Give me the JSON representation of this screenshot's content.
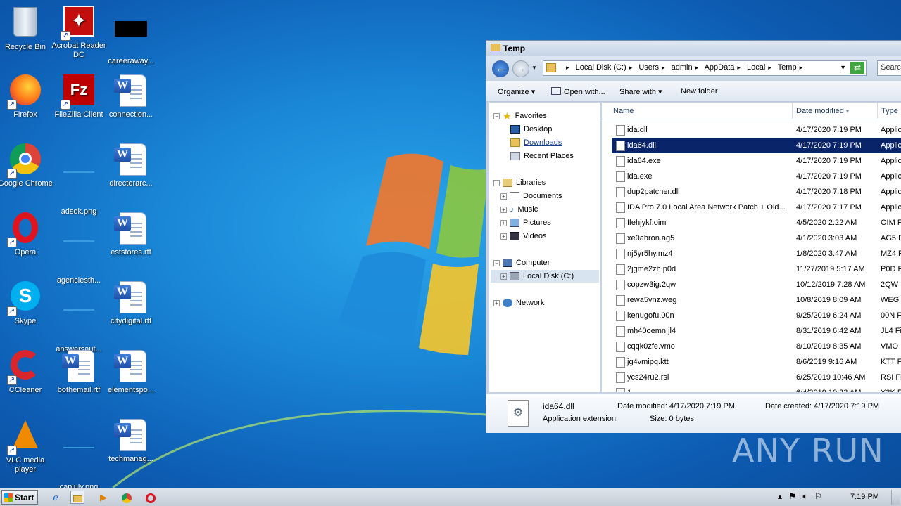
{
  "desktop_icons": [
    {
      "label": "Recycle Bin",
      "icon": "recycle-bin-icon"
    },
    {
      "label": "Acrobat Reader DC",
      "icon": "acrobat-icon"
    },
    {
      "label": "careeraway...",
      "icon": "black-file-icon"
    },
    {
      "label": "Firefox",
      "icon": "firefox-icon"
    },
    {
      "label": "FileZilla Client",
      "icon": "filezilla-icon"
    },
    {
      "label": "connection...",
      "icon": "word-doc-icon"
    },
    {
      "label": "Google Chrome",
      "icon": "chrome-icon"
    },
    {
      "label": "adsok.png",
      "icon": "png-file-icon"
    },
    {
      "label": "directorarc...",
      "icon": "word-doc-icon"
    },
    {
      "label": "Opera",
      "icon": "opera-icon"
    },
    {
      "label": "agenciesth...",
      "icon": "png-file-icon"
    },
    {
      "label": "eststores.rtf",
      "icon": "word-doc-icon"
    },
    {
      "label": "Skype",
      "icon": "skype-icon"
    },
    {
      "label": "answersaut...",
      "icon": "png-file-icon"
    },
    {
      "label": "citydigital.rtf",
      "icon": "word-doc-icon"
    },
    {
      "label": "CCleaner",
      "icon": "ccleaner-icon"
    },
    {
      "label": "bothemail.rtf",
      "icon": "word-doc-icon"
    },
    {
      "label": "elementspo...",
      "icon": "word-doc-icon"
    },
    {
      "label": "VLC media player",
      "icon": "vlc-icon"
    },
    {
      "label": "canjuly.png",
      "icon": "png-file-icon"
    },
    {
      "label": "techmanag...",
      "icon": "word-doc-icon"
    }
  ],
  "window": {
    "title": "Temp",
    "address": [
      "Local Disk (C:)",
      "Users",
      "admin",
      "AppData",
      "Local",
      "Temp"
    ],
    "search_placeholder": "Search",
    "toolbar": {
      "organize": "Organize",
      "open_with": "Open with...",
      "share_with": "Share with",
      "new_folder": "New folder"
    },
    "nav": {
      "favorites": "Favorites",
      "desktop": "Desktop",
      "downloads": "Downloads",
      "recent": "Recent Places",
      "libraries": "Libraries",
      "documents": "Documents",
      "music": "Music",
      "pictures": "Pictures",
      "videos": "Videos",
      "computer": "Computer",
      "localdisk": "Local Disk (C:)",
      "network": "Network"
    },
    "columns": {
      "name": "Name",
      "date": "Date modified",
      "type": "Type"
    },
    "files": [
      {
        "name": "ida.dll",
        "date": "4/17/2020 7:19 PM",
        "type": "Applic"
      },
      {
        "name": "ida64.dll",
        "date": "4/17/2020 7:19 PM",
        "type": "Applic"
      },
      {
        "name": "ida64.exe",
        "date": "4/17/2020 7:19 PM",
        "type": "Applic"
      },
      {
        "name": "ida.exe",
        "date": "4/17/2020 7:19 PM",
        "type": "Applic"
      },
      {
        "name": "dup2patcher.dll",
        "date": "4/17/2020 7:18 PM",
        "type": "Applic"
      },
      {
        "name": "IDA Pro 7.0 Local  Area Network Patch + Old...",
        "date": "4/17/2020 7:17 PM",
        "type": "Applic"
      },
      {
        "name": "ffehjykf.oim",
        "date": "4/5/2020 2:22 AM",
        "type": "OIM F"
      },
      {
        "name": "xe0abron.ag5",
        "date": "4/1/2020 3:03 AM",
        "type": "AG5 F"
      },
      {
        "name": "nj5yr5hy.mz4",
        "date": "1/8/2020 3:47 AM",
        "type": "MZ4 F"
      },
      {
        "name": "2jgme2zh.p0d",
        "date": "11/27/2019 5:17 AM",
        "type": "P0D F"
      },
      {
        "name": "copzw3ig.2qw",
        "date": "10/12/2019 7:28 AM",
        "type": "2QW F"
      },
      {
        "name": "rewa5vnz.weg",
        "date": "10/8/2019 8:09 AM",
        "type": "WEG F"
      },
      {
        "name": "kenugofu.00n",
        "date": "9/25/2019 6:24 AM",
        "type": "00N F"
      },
      {
        "name": "mh40oemn.jl4",
        "date": "8/31/2019 6:42 AM",
        "type": "JL4 Fi"
      },
      {
        "name": "cqqk0zfe.vmo",
        "date": "8/10/2019 8:35 AM",
        "type": "VMO F"
      },
      {
        "name": "jg4vmipq.ktt",
        "date": "8/6/2019 9:16 AM",
        "type": "KTT Fi"
      },
      {
        "name": "ycs24ru2.rsi",
        "date": "6/25/2019 10:46 AM",
        "type": "RSI Fi"
      },
      {
        "name": "1...",
        "date": "6/4/2019 10:22 AM",
        "type": "Y3K Fi"
      }
    ],
    "details": {
      "name": "ida64.dll",
      "kind": "Application extension",
      "modified_label": "Date modified:",
      "modified": "4/17/2020 7:19 PM",
      "size_label": "Size:",
      "size": "0 bytes",
      "created_label": "Date created:",
      "created": "4/17/2020 7:19 PM"
    }
  },
  "taskbar": {
    "start": "Start",
    "clock": "7:19 PM"
  },
  "watermark": "ANY RUN"
}
